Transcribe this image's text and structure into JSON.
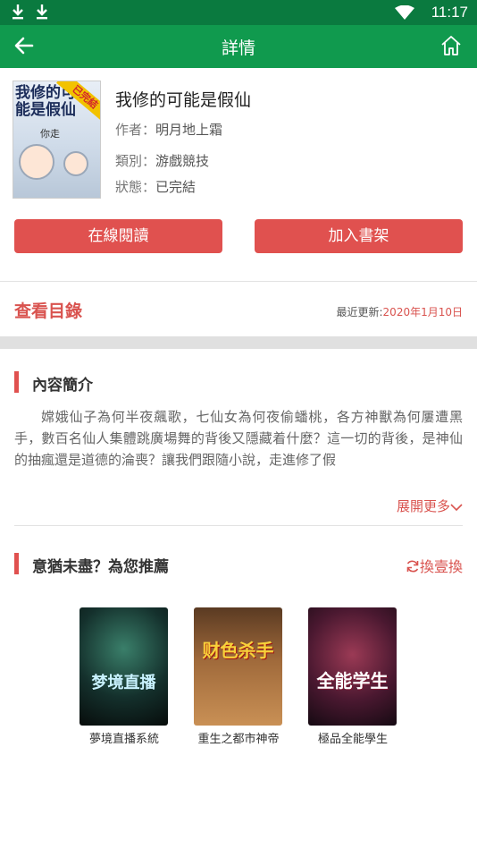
{
  "status_bar": {
    "time": "11:17"
  },
  "app_bar": {
    "title": "詳情"
  },
  "book": {
    "title": "我修的可能是假仙",
    "cover_title": "我修的可能是假仙",
    "cover_sub": "你走",
    "cover_badge": "已完結",
    "author_label": "作者：",
    "author": "明月地上霜",
    "category_label": "類別：",
    "category": "游戲競技",
    "status_label": "狀態：",
    "status": "已完結"
  },
  "actions": {
    "read_label": "在線閱讀",
    "add_label": "加入書架"
  },
  "catalog": {
    "label": "查看目錄",
    "update_prefix": "最近更新:",
    "update_date": "2020年1月10日"
  },
  "intro": {
    "heading": "內容簡介",
    "text": "嫦娥仙子為何半夜飆歌，七仙女為何夜偷蟠桃，各方神獸為何屢遭黑手，數百名仙人集體跳廣場舞的背後又隱藏着什麼？這一切的背後，是神仙的抽瘋還是道德的淪喪？讓我們跟隨小說，走進修了假",
    "more_label": "展開更多"
  },
  "recommend": {
    "heading": "意猶未盡？為您推薦",
    "swap_label": "換壹換",
    "books": [
      {
        "name": "夢境直播系統",
        "cover_text": "梦境直播"
      },
      {
        "name": "重生之都市神帝",
        "cover_text": "财色杀手"
      },
      {
        "name": "極品全能學生",
        "cover_text": "全能学生"
      }
    ]
  },
  "colors": {
    "status_bar": "#0a7a3f",
    "app_bar": "#109a4e",
    "accent": "#e0514f"
  }
}
